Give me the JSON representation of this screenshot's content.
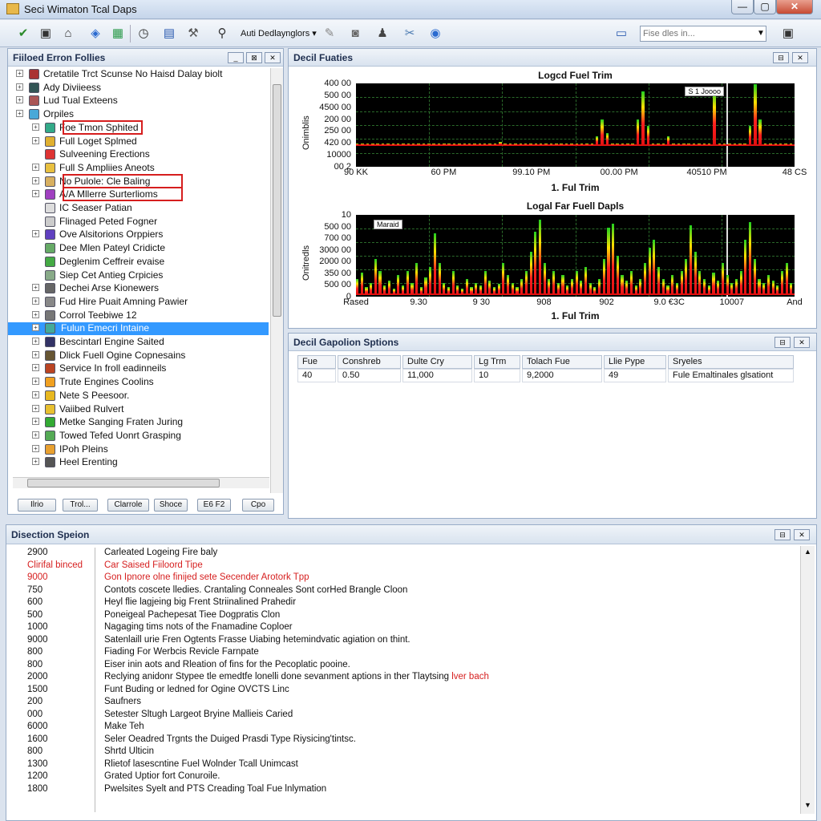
{
  "window": {
    "title": "Seci Wimaton Tcal Daps",
    "minimize": "—",
    "maximize": "▢",
    "close": "✕"
  },
  "toolbar": {
    "label": "Auti Dedlaynglors ▾",
    "search_placeholder": "Fise dles in...",
    "icons": [
      "check-icon",
      "box-icon",
      "building-icon",
      "puzzle-icon",
      "grid-icon",
      "clock-icon",
      "table-icon",
      "tool-icon",
      "search-icon",
      "pen-icon",
      "camera-icon",
      "person-icon",
      "scissors-icon",
      "globe-icon",
      "monitor-icon",
      "window-icon"
    ]
  },
  "tree_panel": {
    "title": "Fiiloed Erron Follies",
    "items": [
      {
        "label": "Cretatile Trct Scunse No Haisd Dalay biolt",
        "color": "#a33",
        "indent": 0,
        "expand": "⊞"
      },
      {
        "label": "Ady Diviieess",
        "color": "#355",
        "indent": 0,
        "expand": "⊞"
      },
      {
        "label": "Lud Tual Exteens",
        "color": "#a55",
        "indent": 0,
        "expand": "⊞"
      },
      {
        "label": "Orpiles",
        "color": "#4aa8d8",
        "indent": 0,
        "expand": "⊞"
      },
      {
        "label": "Foe Tmon Sphited",
        "color": "#3a8",
        "indent": 1,
        "expand": "⊞"
      },
      {
        "label": "Full Loget Splmed",
        "color": "#e0b030",
        "indent": 1,
        "expand": "⊞"
      },
      {
        "label": "Sulveening Erections",
        "color": "#d33",
        "indent": 1,
        "expand": ""
      },
      {
        "label": "Full S Ampliies Aneots",
        "color": "#e8c040",
        "indent": 1,
        "expand": "⊞"
      },
      {
        "label": "No Pulole: Cle Baling",
        "color": "#d8b060",
        "indent": 1,
        "expand": "⊞"
      },
      {
        "label": "A/A Mllerre Surterlioms",
        "color": "#a040c0",
        "indent": 1,
        "expand": "⊞"
      },
      {
        "label": "IC Seaser Patian",
        "color": "#ddd",
        "indent": 1,
        "expand": ""
      },
      {
        "label": "Flinaged Peted Fogner",
        "color": "#ccc",
        "indent": 1,
        "expand": ""
      },
      {
        "label": "Ove Alsitorions Orppiers",
        "color": "#6040c0",
        "indent": 1,
        "expand": "⊞"
      },
      {
        "label": "Dee Mlen Pateyl Cridicte",
        "color": "#6a6",
        "indent": 1,
        "expand": ""
      },
      {
        "label": "Deglenim Ceffreir evaise",
        "color": "#4a4",
        "indent": 1,
        "expand": ""
      },
      {
        "label": "Siep Cet Antieg Crpicies",
        "color": "#8a8",
        "indent": 1,
        "expand": ""
      },
      {
        "label": "Dechei Arse Kionewers",
        "color": "#666",
        "indent": 1,
        "expand": "⊞"
      },
      {
        "label": "Fud Hire Puait Amning Pawier",
        "color": "#888",
        "indent": 1,
        "expand": "⊞"
      },
      {
        "label": "Corrol Teebiwe 12",
        "color": "#777",
        "indent": 1,
        "expand": "⊞"
      },
      {
        "label": "Fulun Emecri Intaine",
        "color": "#4a9",
        "indent": 1,
        "expand": "⊞",
        "selected": true
      },
      {
        "label": "Bescintarl Engine Saited",
        "color": "#336",
        "indent": 1,
        "expand": "⊞"
      },
      {
        "label": "Dlick Fuell Ogine Copnesains",
        "color": "#653",
        "indent": 1,
        "expand": "⊞"
      },
      {
        "label": "Service In froll eadinneils",
        "color": "#b42",
        "indent": 1,
        "expand": "⊞"
      },
      {
        "label": "Trute Engines Coolins",
        "color": "#f0a020",
        "indent": 1,
        "expand": "⊞"
      },
      {
        "label": "Nete S Peesoor.",
        "color": "#e8b820",
        "indent": 1,
        "expand": "⊞"
      },
      {
        "label": "Vaiibed Rulvert",
        "color": "#e8c030",
        "indent": 1,
        "expand": "⊞"
      },
      {
        "label": "Metke Sanging Fraten Juring",
        "color": "#3a3",
        "indent": 1,
        "expand": "⊞"
      },
      {
        "label": "Towed Tefed Uonrt Grasping",
        "color": "#5a5",
        "indent": 1,
        "expand": "⊞"
      },
      {
        "label": "IPoh Pleins",
        "color": "#e8a030",
        "indent": 1,
        "expand": "⊞"
      },
      {
        "label": "Heel Erenting",
        "color": "#555",
        "indent": 1,
        "expand": "⊞"
      }
    ],
    "buttons": [
      "Ilrio",
      "Trol...",
      "Clarrole",
      "Shoce",
      "E6 F2",
      "Cpo"
    ]
  },
  "chart_panel": {
    "title": "Decil Fuaties"
  },
  "chart_data": [
    {
      "type": "bar",
      "title": "Logcd Fuel Trim",
      "xlabel": "1. Ful Trim",
      "ylabel": "Onimblis",
      "yticks": [
        "400 00",
        "500 00",
        "4500 00",
        "200 00",
        "250 00",
        "420 00",
        "10000",
        "00 2"
      ],
      "xticks": [
        "90 KK",
        "60 PM",
        "99.10 PM",
        "00.00 PM",
        "40510 PM",
        "48 CS"
      ],
      "legend": "S 1 Joooo",
      "series_colors": [
        "#e01010",
        "#ff2020",
        "#ffe000",
        "#20d020"
      ],
      "values": [
        2,
        2,
        3,
        2,
        2,
        3,
        2,
        2,
        4,
        3,
        2,
        2,
        5,
        6,
        3,
        2,
        2,
        2,
        4,
        8,
        5,
        3,
        2,
        2,
        2,
        3,
        2,
        6,
        14,
        4,
        3,
        2,
        2,
        2,
        2,
        3,
        2,
        2,
        3,
        7,
        5,
        2,
        3,
        2,
        2,
        3,
        4,
        18,
        30,
        20,
        10,
        8,
        12,
        6,
        4,
        30,
        50,
        25,
        8,
        5,
        6,
        18,
        3,
        4,
        5,
        2,
        3,
        2,
        2,
        2,
        50,
        12,
        6,
        8,
        4,
        2,
        3,
        25,
        55,
        30,
        6,
        4,
        2,
        3,
        2,
        2
      ]
    },
    {
      "type": "bar",
      "title": "Logal Far Fuell Dapls",
      "xlabel": "1. Ful Trim",
      "ylabel": "Onitredls",
      "yticks": [
        "10",
        "500 00",
        "700 00",
        "3000 00",
        "2000 00",
        "350 00",
        "500 00",
        "0"
      ],
      "xticks": [
        "Rased",
        "9.30",
        "9 30",
        "908",
        "902",
        "9.0 €3C",
        "10007",
        "And"
      ],
      "legend": "Maraid",
      "series_colors": [
        "#e01010",
        "#ff2020",
        "#ffe000",
        "#20d020"
      ],
      "values": [
        20,
        28,
        10,
        15,
        45,
        30,
        12,
        18,
        8,
        25,
        12,
        30,
        15,
        40,
        10,
        22,
        35,
        78,
        40,
        15,
        10,
        30,
        12,
        8,
        20,
        10,
        15,
        12,
        30,
        18,
        10,
        14,
        40,
        25,
        15,
        10,
        20,
        30,
        55,
        80,
        95,
        40,
        20,
        30,
        15,
        25,
        12,
        20,
        30,
        18,
        35,
        15,
        10,
        20,
        45,
        85,
        90,
        50,
        25,
        18,
        30,
        12,
        20,
        40,
        60,
        70,
        35,
        20,
        12,
        25,
        15,
        30,
        45,
        88,
        55,
        30,
        20,
        12,
        28,
        18,
        40,
        25,
        15,
        20,
        30,
        70,
        92,
        45,
        20,
        15,
        25,
        18,
        12,
        30,
        40,
        15
      ]
    }
  ],
  "table_panel": {
    "title": "Decil Gapolion Sptions",
    "columns": [
      "Fue",
      "Conshreb",
      "Dulte Cry",
      "Lg Trm",
      "Tolach Fue",
      "Llie Pype",
      "Sryeles"
    ],
    "rows": [
      [
        "40",
        "0.50",
        "11,000",
        "10",
        "9,2000",
        "49",
        "Fule Emaltinales glsationt"
      ]
    ]
  },
  "log_panel": {
    "title": "Disection Speion",
    "rows": [
      {
        "code": "2900",
        "text": "Carleated Logeing Fire baly",
        "red": false
      },
      {
        "code": "Clirifal binced",
        "text": "Car Saised Fiiloord Tipe",
        "red": true
      },
      {
        "code": "9000",
        "text": "Gon Ipnore olne finijed sete Secender Arotork Tpp",
        "red": true
      },
      {
        "code": "750",
        "text": "Contots coscete lledies. Crantaling Conneales Sont corHed Brangle Cloon",
        "red": false
      },
      {
        "code": "600",
        "text": "Heyl flie lagjeing big Frent Striinalined Prahedir",
        "red": false
      },
      {
        "code": "500",
        "text": "Poneigeal Pachepesat Tiee Dogpratis Clon",
        "red": false
      },
      {
        "code": "1000",
        "text": "Nagaging tims nots of the Fnamadine Coploer",
        "red": false
      },
      {
        "code": "9000",
        "text": "Satenlaill urie Fren Ogtents Frasse Uiabing hetemindvatic agiation on thint.",
        "red": false
      },
      {
        "code": "800",
        "text": "Fiading For Werbcis Revicle Farnpate",
        "red": false
      },
      {
        "code": "800",
        "text": "Eiser inin aots and Rleation of fins for the Pecoplatic pooine.",
        "red": false
      },
      {
        "code": "2000",
        "text": "Reclying anidonr Stypee tle emedtfe lonelli done sevanment aptions in ther Tlaytsing",
        "red": false,
        "tail": "lver bach"
      },
      {
        "code": "1500",
        "text": "Funt Buding or ledned for Ogine OVCTS Linc",
        "red": false
      },
      {
        "code": "200",
        "text": "Saufners",
        "red": false
      },
      {
        "code": "000",
        "text": "Setester Sltugh Largeot Bryine Mallieis Caried",
        "red": false
      },
      {
        "code": "6000",
        "text": "Make Teh",
        "red": false
      },
      {
        "code": "1600",
        "text": "Seler Oeadred Trgnts the Duiged Prasdi Type Riysicing'tintsc.",
        "red": false
      },
      {
        "code": "800",
        "text": "Shrtd Ulticin",
        "red": false
      },
      {
        "code": "1300",
        "text": "Rlietof lasescntine Fuel Wolnder Tcall Unimcast",
        "red": false
      },
      {
        "code": "1200",
        "text": "Grated Uptior fort Conuroile.",
        "red": false
      },
      {
        "code": "1800",
        "text": "Pwelsites Syelt and PTS Creading Toal Fue lnlymation",
        "red": false
      }
    ]
  }
}
